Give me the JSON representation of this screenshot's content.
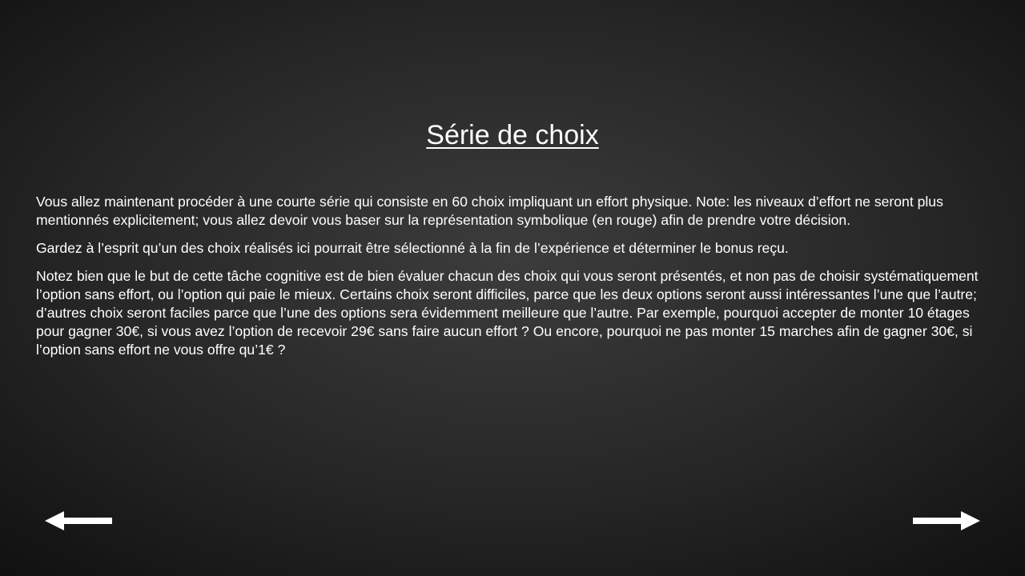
{
  "slide": {
    "title": "Série de choix",
    "paragraphs": [
      "Vous allez maintenant procéder à une courte série qui consiste en 60 choix impliquant un effort physique. Note: les niveaux d’effort ne seront plus mentionnés explicitement; vous allez devoir vous baser sur la représentation symbolique (en rouge) afin de prendre votre décision.",
      "Gardez à l’esprit qu’un des choix réalisés ici pourrait être sélectionné à la fin de l’expérience et déterminer le bonus reçu.",
      "Notez bien que le but de cette tâche cognitive est de bien évaluer chacun des choix qui vous seront présentés, et non pas de choisir systématiquement l’option sans effort, ou l’option qui paie le mieux. Certains choix seront difficiles, parce que les deux options seront aussi intéressantes l’une que l’autre; d’autres choix seront faciles parce que l’une des options sera évidemment meilleure que l’autre. Par exemple, pourquoi accepter de monter 10 étages pour gagner 30€, si vous avez l’option de recevoir 29€ sans faire aucun effort ? Ou encore, pourquoi ne pas monter 15 marches afin de gagner 30€, si l’option sans effort ne vous offre qu’1€ ?"
    ]
  },
  "navigation": {
    "previous_icon": "arrow-left-icon",
    "next_icon": "arrow-right-icon"
  },
  "colors": {
    "text": "#ffffff",
    "background_center": "#3c3c3c",
    "background_edge": "#101010"
  }
}
